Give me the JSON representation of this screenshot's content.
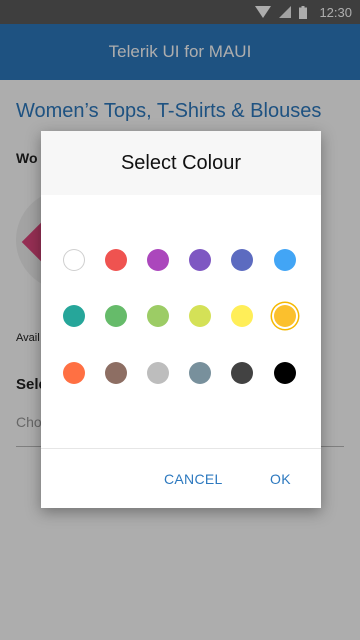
{
  "status_bar": {
    "time": "12:30"
  },
  "app_bar": {
    "title": "Telerik UI for MAUI"
  },
  "page": {
    "title": "Women’s Tops, T-Shirts & Blouses",
    "section_label": "Wo",
    "availability_label": "Avail",
    "select_label": "Sele",
    "choose_placeholder": "Cho"
  },
  "dialog": {
    "title": "Select Colour",
    "cancel_label": "CANCEL",
    "ok_label": "OK",
    "selected_color": "#fbc02d",
    "colors": [
      [
        "#ffffff",
        "#ef5350",
        "#ab47bc",
        "#7e57c2",
        "#5c6bc0",
        "#42a5f5"
      ],
      [
        "#26a69a",
        "#66bb6a",
        "#9ccc65",
        "#d4e157",
        "#ffee58",
        "#fbc02d"
      ],
      [
        "#ff7043",
        "#8d6e63",
        "#bdbdbd",
        "#78909c",
        "#424242",
        "#000000"
      ]
    ]
  }
}
